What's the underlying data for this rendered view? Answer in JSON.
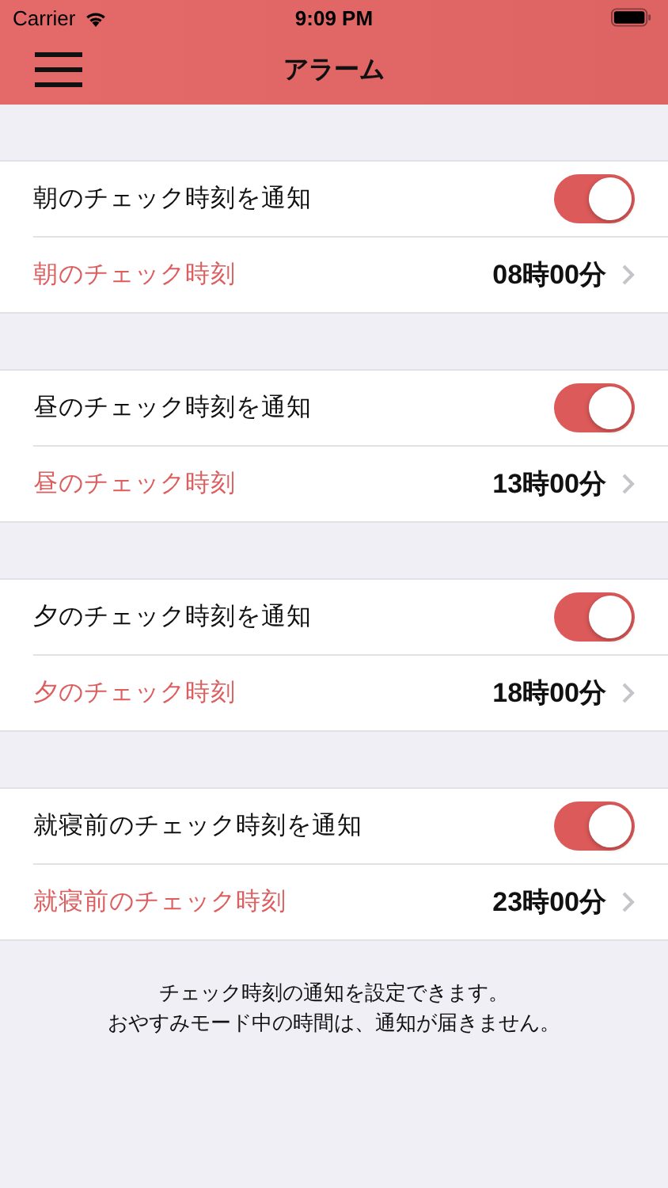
{
  "status_bar": {
    "carrier": "Carrier",
    "time": "9:09 PM"
  },
  "nav_bar": {
    "title": "アラーム"
  },
  "sections": [
    {
      "toggle_label": "朝のチェック時刻を通知",
      "on": true,
      "time_label": "朝のチェック時刻",
      "time": "08時00分"
    },
    {
      "toggle_label": "昼のチェック時刻を通知",
      "on": true,
      "time_label": "昼のチェック時刻",
      "time": "13時00分"
    },
    {
      "toggle_label": "夕のチェック時刻を通知",
      "on": true,
      "time_label": "夕のチェック時刻",
      "time": "18時00分"
    },
    {
      "toggle_label": "就寝前のチェック時刻を通知",
      "on": true,
      "time_label": "就寝前のチェック時刻",
      "time": "23時00分"
    }
  ],
  "footer": [
    "チェック時刻の通知を設定できます。",
    "おやすみモード中の時間は、通知が届きません。"
  ]
}
